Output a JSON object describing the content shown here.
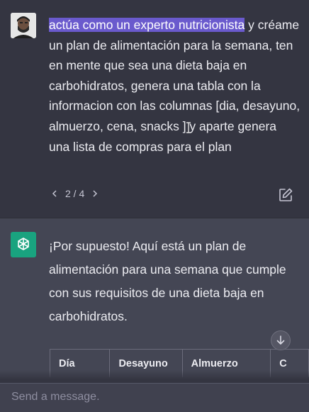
{
  "user_message": {
    "highlighted": "actúa como un experto nutricionista",
    "rest": " y créame un plan de alimentación para la semana, ten en mente que sea una dieta baja en carbohidratos, genera una tabla con la informacion con las columnas [dia, desayuno, almuerzo, cena, snacks ] y aparte genera una lista de compras para el plan"
  },
  "pager": {
    "label": "2 / 4"
  },
  "assistant_message": {
    "text": "¡Por supuesto! Aquí está un plan de alimentación para una semana que cumple con sus requisitos de una dieta baja en carbohidratos."
  },
  "table": {
    "headers": [
      "Día",
      "Desayuno",
      "Almuerzo",
      "C"
    ]
  },
  "composer": {
    "placeholder": "Send a message."
  },
  "icons": {
    "prev": "chevron-left-icon",
    "next": "chevron-right-icon",
    "edit": "edit-icon",
    "scroll": "arrow-down-icon",
    "assistant": "openai-logo-icon"
  },
  "colors": {
    "page_bg": "#343541",
    "assistant_bg": "#444654",
    "highlight": "#6a5acd",
    "assistant_avatar": "#19a37f"
  }
}
